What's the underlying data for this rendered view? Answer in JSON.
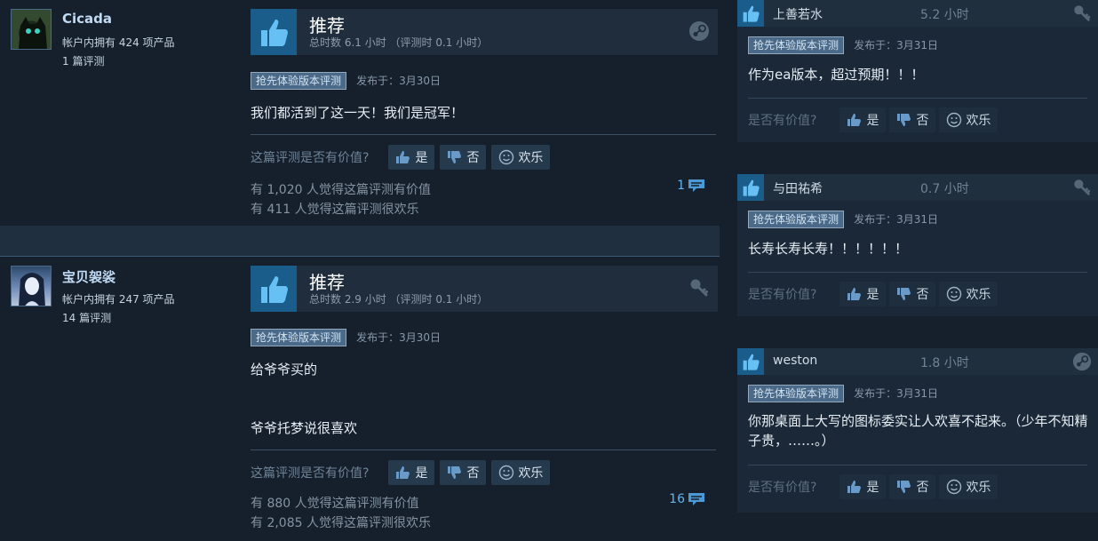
{
  "colors": {
    "background": "#1b2838",
    "card": "#16202d",
    "thumb_bg": "#1a5d8b",
    "badge_bg": "#4b6a8a",
    "link_blue": "#62b3f0"
  },
  "vote_labels": {
    "yes": "是",
    "no": "否",
    "funny": "欢乐"
  },
  "reviews": [
    {
      "author": {
        "name": "Cicada",
        "products": "帐户内拥有 424 项产品",
        "review_count": "1 篇评测",
        "avatar_icon": "black-cat-avatar"
      },
      "recommendation": "推荐",
      "hours": "总时数 6.1 小时 （评测时 0.1 小时）",
      "platform_icon": "steam-icon",
      "badge": "抢先体验版本评测",
      "posted": "发布于：3月30日",
      "content": [
        "我们都活到了这一天！我们是冠军！"
      ],
      "helpful_question": "这篇评测是否有价值?",
      "helpful_count": "有 1,020 人觉得这篇评测有价值",
      "funny_count": "有 411 人觉得这篇评测很欢乐",
      "comments": "1"
    },
    {
      "author": {
        "name": "宝贝袈裟",
        "products": "帐户内拥有 247 项产品",
        "review_count": "14 篇评测",
        "avatar_icon": "anime-girl-avatar"
      },
      "recommendation": "推荐",
      "hours": "总时数 2.9 小时 （评测时 0.1 小时）",
      "platform_icon": "key-icon",
      "badge": "抢先体验版本评测",
      "posted": "发布于：3月30日",
      "content": [
        "给爷爷买的",
        "爷爷托梦说很喜欢"
      ],
      "helpful_question": "这篇评测是否有价值?",
      "helpful_count": "有 880 人觉得这篇评测有价值",
      "funny_count": "有 2,085 人觉得这篇评测很欢乐",
      "comments": "16"
    }
  ],
  "mini_reviews": [
    {
      "name": "上善若水",
      "hours": "5.2 小时",
      "platform_icon": "key-icon",
      "badge": "抢先体验版本评测",
      "posted": "发布于：3月31日",
      "content": "作为ea版本，超过预期！！！",
      "helpful_question": "是否有价值?"
    },
    {
      "name": "与田祐希",
      "hours": "0.7 小时",
      "platform_icon": "key-icon",
      "badge": "抢先体验版本评测",
      "posted": "发布于：3月31日",
      "content": "长寿长寿长寿！！！！！！",
      "helpful_question": "是否有价值?"
    },
    {
      "name": "weston",
      "hours": "1.8 小时",
      "platform_icon": "steam-icon",
      "badge": "抢先体验版本评测",
      "posted": "发布于：3月31日",
      "content": "你那桌面上大写的图标委实让人欢喜不起来。（少年不知精子贵，……。）",
      "helpful_question": "是否有价值?"
    }
  ]
}
